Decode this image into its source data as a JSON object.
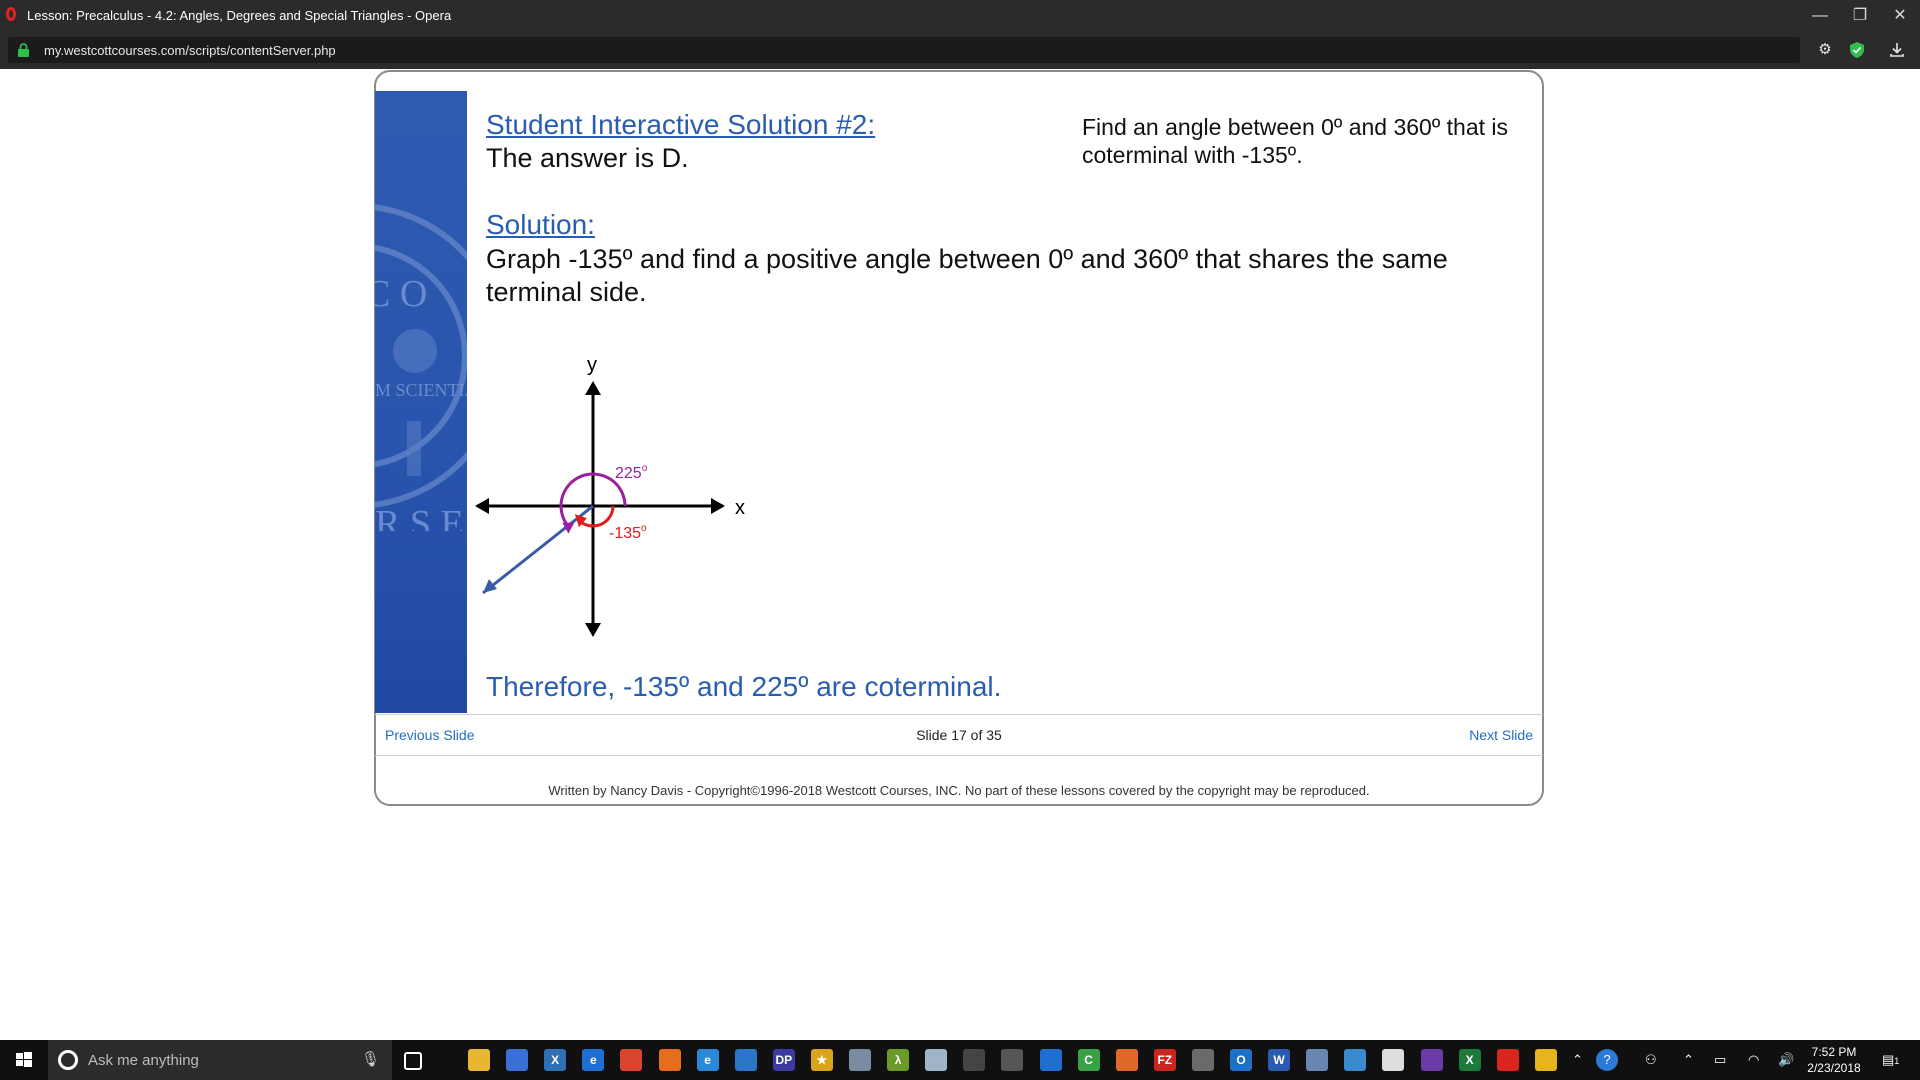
{
  "window": {
    "title": "Lesson: Precalculus - 4.2: Angles, Degrees and Special Triangles - Opera",
    "controls": {
      "minimize": "—",
      "restore": "❐",
      "close": "✕"
    }
  },
  "address_bar": {
    "url": "my.westcottcourses.com/scripts/contentServer.php",
    "icons": [
      "lock-icon",
      "gear-icon",
      "shield-icon",
      "download-icon"
    ]
  },
  "slide": {
    "heading": "Student Interactive Solution #2:",
    "answer": "The answer is D.",
    "question": "Find an angle between 0º and 360º that is coterminal with -135º.",
    "solution_heading": "Solution:",
    "solution_text": "Graph -135º and find a positive angle between 0º and 360º that shares the same terminal side.",
    "conclusion": "Therefore, -135º and 225º are coterminal.",
    "seal_text": {
      "top": "C O",
      "middle": "M SCIENTIA",
      "bottom": "R S E"
    }
  },
  "diagram": {
    "x_label": "x",
    "y_label": "y",
    "angle_positive": {
      "label": "225",
      "degrees": 225,
      "color": "#9b1fa0"
    },
    "angle_negative": {
      "label": "-135",
      "degrees": -135,
      "color": "#e01b1b"
    },
    "degree_symbol": "o",
    "terminal_color": "#3a5ca8"
  },
  "nav": {
    "previous": "Previous Slide",
    "counter": "Slide 17 of 35",
    "current": 17,
    "total": 35,
    "next": "Next Slide"
  },
  "footer": {
    "copyright": "Written by Nancy Davis - Copyright©1996-2018 Westcott Courses, INC. No part of these lessons covered by the copyright may be reproduced."
  },
  "taskbar": {
    "search_placeholder": "Ask me anything",
    "time": "7:52 PM",
    "date": "2/23/2018",
    "notification_count": "1",
    "pinned_apps": [
      {
        "name": "file-explorer-icon",
        "color": "#e8b632",
        "glyph": ""
      },
      {
        "name": "store-icon",
        "color": "#3a6fd8",
        "glyph": ""
      },
      {
        "name": "x-app-icon",
        "color": "#2f6fb5",
        "glyph": "X"
      },
      {
        "name": "edge-icon",
        "color": "#1e6fd0",
        "glyph": "e"
      },
      {
        "name": "chrome-icon",
        "color": "#d8442f",
        "glyph": ""
      },
      {
        "name": "firefox-icon",
        "color": "#e66d1e",
        "glyph": ""
      },
      {
        "name": "ie-icon",
        "color": "#2a8ad8",
        "glyph": "e"
      },
      {
        "name": "powershell-icon",
        "color": "#2a76c6",
        "glyph": ""
      },
      {
        "name": "dp-app-icon",
        "color": "#3a3aa0",
        "glyph": "DP"
      },
      {
        "name": "star-app-icon",
        "color": "#d9a41c",
        "glyph": "★"
      },
      {
        "name": "tool-app-icon",
        "color": "#7a8aa0",
        "glyph": ""
      },
      {
        "name": "lambda-app-icon",
        "color": "#6a9a2a",
        "glyph": "λ"
      },
      {
        "name": "pencil-app-icon",
        "color": "#a0b4c8",
        "glyph": ""
      },
      {
        "name": "unity-app-icon",
        "color": "#444444",
        "glyph": ""
      },
      {
        "name": "calculator-icon",
        "color": "#555555",
        "glyph": ""
      },
      {
        "name": "teamviewer-icon",
        "color": "#1e6fd0",
        "glyph": ""
      },
      {
        "name": "camtasia-icon",
        "color": "#3aa046",
        "glyph": "C"
      },
      {
        "name": "xampp-icon",
        "color": "#e0682a",
        "glyph": ""
      },
      {
        "name": "filezilla-icon",
        "color": "#c8261e",
        "glyph": "FZ"
      },
      {
        "name": "sublime-icon",
        "color": "#6a6a6a",
        "glyph": ""
      },
      {
        "name": "outlook-icon",
        "color": "#1e6fc8",
        "glyph": "O"
      },
      {
        "name": "word-icon",
        "color": "#2b5bb0",
        "glyph": "W"
      },
      {
        "name": "network-app-icon",
        "color": "#6a86b0",
        "glyph": ""
      },
      {
        "name": "remote-app-icon",
        "color": "#3a8ad0",
        "glyph": ""
      },
      {
        "name": "mail-icon",
        "color": "#dddddd",
        "glyph": ""
      },
      {
        "name": "visual-studio-icon",
        "color": "#6a3aa8",
        "glyph": ""
      },
      {
        "name": "excel-icon",
        "color": "#1e7a3a",
        "glyph": "X"
      },
      {
        "name": "opera-icon",
        "color": "#d8261e",
        "glyph": ""
      },
      {
        "name": "slides-app-icon",
        "color": "#e8b41e",
        "glyph": ""
      }
    ]
  }
}
